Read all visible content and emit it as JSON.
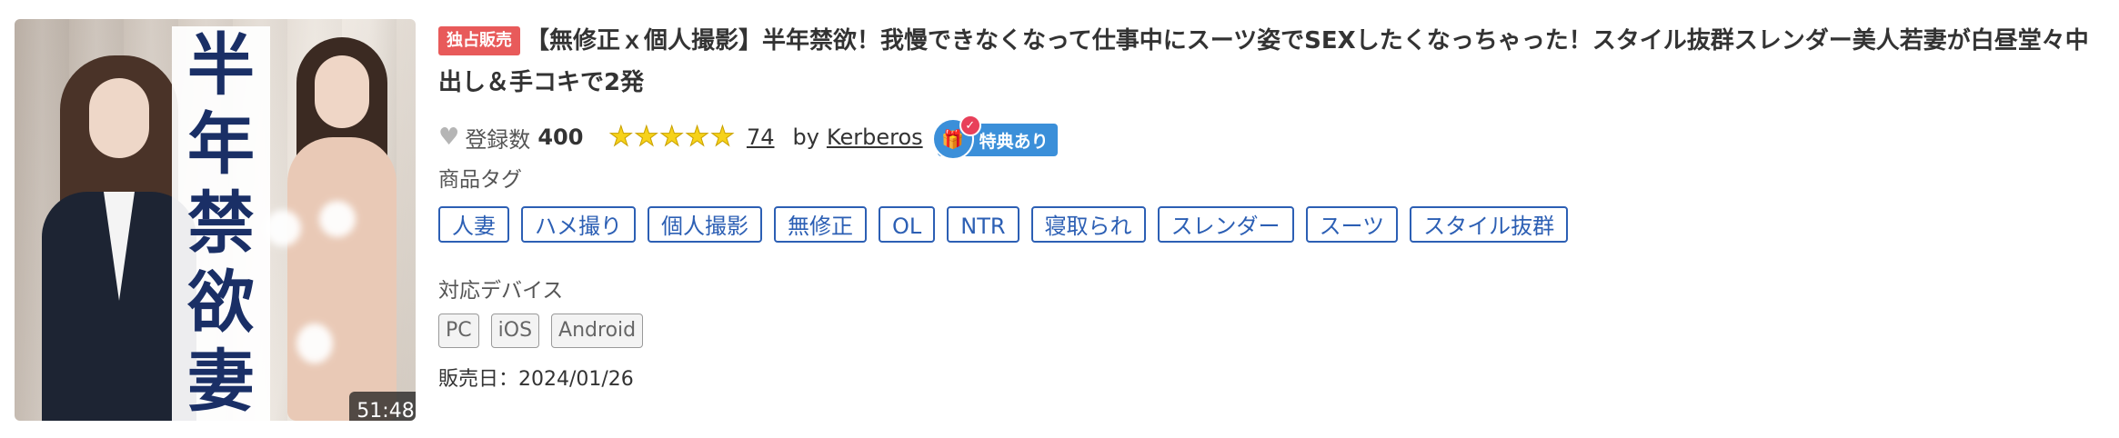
{
  "thumbnail": {
    "vertical_title": [
      "半",
      "年",
      "禁",
      "欲",
      "妻"
    ],
    "duration": "51:48"
  },
  "product": {
    "badge": "独占販売",
    "title": "【無修正ｘ個人撮影】半年禁欲！我慢できなくなって仕事中にスーツ姿でSEXしたくなっちゃった！スタイル抜群スレンダー美人若妻が白昼堂々中出し＆手コキで2発",
    "favorites_label": "登録数",
    "favorites_count": "400",
    "rating_stars": 5,
    "review_count": "74",
    "by_label": "by",
    "author": "Kerberos",
    "bonus_label": "特典あり",
    "bonus_icon_glyph": "🎁",
    "bonus_check_glyph": "✓",
    "heart_glyph": "♥",
    "star_glyph": "★"
  },
  "tags_section": {
    "label": "商品タグ",
    "tags": [
      "人妻",
      "ハメ撮り",
      "個人撮影",
      "無修正",
      "OL",
      "NTR",
      "寝取られ",
      "スレンダー",
      "スーツ",
      "スタイル抜群"
    ]
  },
  "devices_section": {
    "label": "対応デバイス",
    "devices": [
      "PC",
      "iOS",
      "Android"
    ]
  },
  "release": {
    "text": "販売日：2024/01/26"
  },
  "colors": {
    "exclusive_badge": "#e85a5a",
    "tag_border": "#2c5fb4",
    "bonus_badge": "#3b8fd9",
    "star": "#f6d21a"
  }
}
